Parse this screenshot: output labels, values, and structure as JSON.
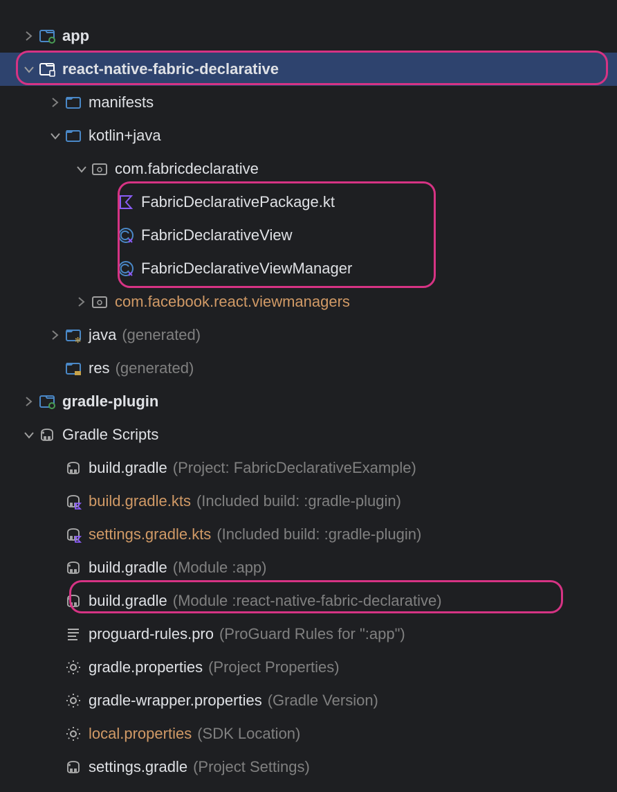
{
  "tree": {
    "app": {
      "label": "app"
    },
    "rnfd": {
      "label": "react-native-fabric-declarative"
    },
    "manifests": {
      "label": "manifests"
    },
    "kotlinjava": {
      "label": "kotlin+java"
    },
    "comfab": {
      "label": "com.fabricdeclarative"
    },
    "fdpkg": {
      "label": "FabricDeclarativePackage.kt"
    },
    "fdview": {
      "label": "FabricDeclarativeView"
    },
    "fdvm": {
      "label": "FabricDeclarativeViewManager"
    },
    "comfb": {
      "label": "com.facebook.react.viewmanagers"
    },
    "javagen": {
      "label": "java",
      "hint": "(generated)"
    },
    "resgen": {
      "label": "res",
      "hint": "(generated)"
    },
    "gradleplugin": {
      "label": "gradle-plugin"
    },
    "gradlescripts": {
      "label": "Gradle Scripts"
    },
    "bg1": {
      "label": "build.gradle",
      "hint": "(Project: FabricDeclarativeExample)"
    },
    "bgkts": {
      "label": "build.gradle.kts",
      "hint": "(Included build: :gradle-plugin)"
    },
    "sgkts": {
      "label": "settings.gradle.kts",
      "hint": "(Included build: :gradle-plugin)"
    },
    "bgapp": {
      "label": "build.gradle",
      "hint": "(Module :app)"
    },
    "bgrnfd": {
      "label": "build.gradle",
      "hint": "(Module :react-native-fabric-declarative)"
    },
    "proguard": {
      "label": "proguard-rules.pro",
      "hint": "(ProGuard Rules for \":app\")"
    },
    "gprop": {
      "label": "gradle.properties",
      "hint": "(Project Properties)"
    },
    "gwprop": {
      "label": "gradle-wrapper.properties",
      "hint": "(Gradle Version)"
    },
    "lprop": {
      "label": "local.properties",
      "hint": "(SDK Location)"
    },
    "sgradle": {
      "label": "settings.gradle",
      "hint": "(Project Settings)"
    }
  }
}
